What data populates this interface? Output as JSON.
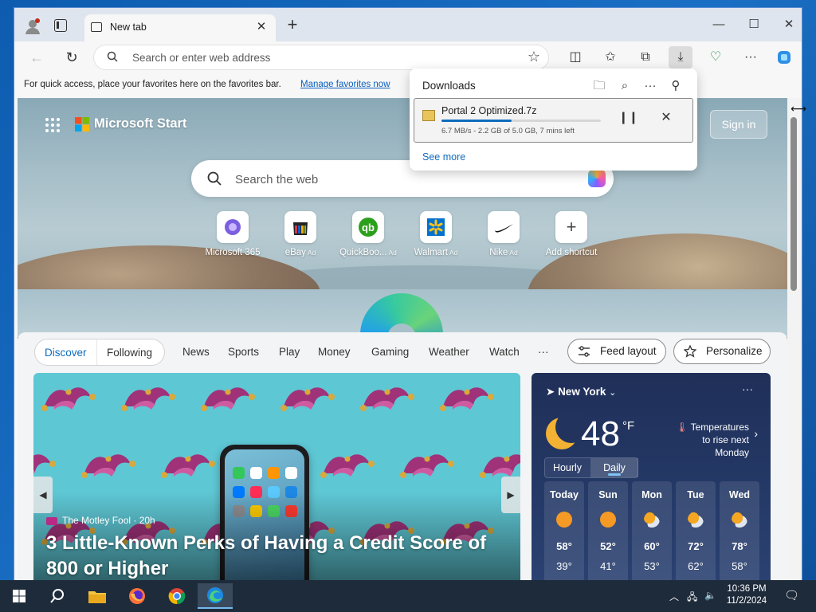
{
  "browser": {
    "tab_title": "New tab",
    "tab_close": "✕",
    "new_tab": "+",
    "window": {
      "minimize": "—",
      "maximize": "☐",
      "close": "✕"
    }
  },
  "address_bar": {
    "placeholder": "Search or enter web address"
  },
  "toolbar": {
    "more": "···"
  },
  "favorites_bar": {
    "text": "For quick access, place your favorites here on the favorites bar.",
    "link": "Manage favorites now"
  },
  "downloads": {
    "title": "Downloads",
    "item": {
      "name": "Portal 2 Optimized.7z",
      "status": "6.7 MB/s - 2.2 GB of 5.0 GB, 7 mins left",
      "progress": 0.44
    },
    "see_more": "See more",
    "more_icon": "···"
  },
  "start_page": {
    "brand": "Microsoft Start",
    "sign_in": "Sign in",
    "search_placeholder": "Search the web",
    "shortcuts": [
      {
        "label": "Microsoft 365",
        "ad": ""
      },
      {
        "label": "eBay",
        "ad": "Ad"
      },
      {
        "label": "QuickBoo...",
        "ad": "Ad"
      },
      {
        "label": "Walmart",
        "ad": "Ad"
      },
      {
        "label": "Nike",
        "ad": "Ad"
      },
      {
        "label": "Add shortcut",
        "ad": ""
      }
    ],
    "add_glyph": "+"
  },
  "feed": {
    "discover": "Discover",
    "following": "Following",
    "categories": [
      "News",
      "Sports",
      "Play",
      "Money",
      "Gaming",
      "Weather",
      "Watch",
      "···"
    ],
    "feed_layout": "Feed layout",
    "personalize": "Personalize",
    "card": {
      "source": "The Motley Fool · 20h",
      "headline": "3 Little-Known Perks of Having a Credit Score of 800 or Higher",
      "prev": "◀",
      "next": "▶"
    }
  },
  "weather": {
    "location": "New York",
    "more": "···",
    "temp": "48",
    "unit": "°F",
    "alert": "Temperatures to rise next Monday",
    "hourly": "Hourly",
    "daily": "Daily",
    "days": [
      {
        "name": "Today",
        "hi": "58°",
        "lo": "39°",
        "icon": "sun"
      },
      {
        "name": "Sun",
        "hi": "52°",
        "lo": "41°",
        "icon": "sun"
      },
      {
        "name": "Mon",
        "hi": "60°",
        "lo": "53°",
        "icon": "partly-cloudy"
      },
      {
        "name": "Tue",
        "hi": "72°",
        "lo": "62°",
        "icon": "partly-cloudy"
      },
      {
        "name": "Wed",
        "hi": "78°",
        "lo": "58°",
        "icon": "partly-cloudy"
      }
    ]
  },
  "taskbar": {
    "time": "10:36 PM",
    "date": "11/2/2024"
  }
}
